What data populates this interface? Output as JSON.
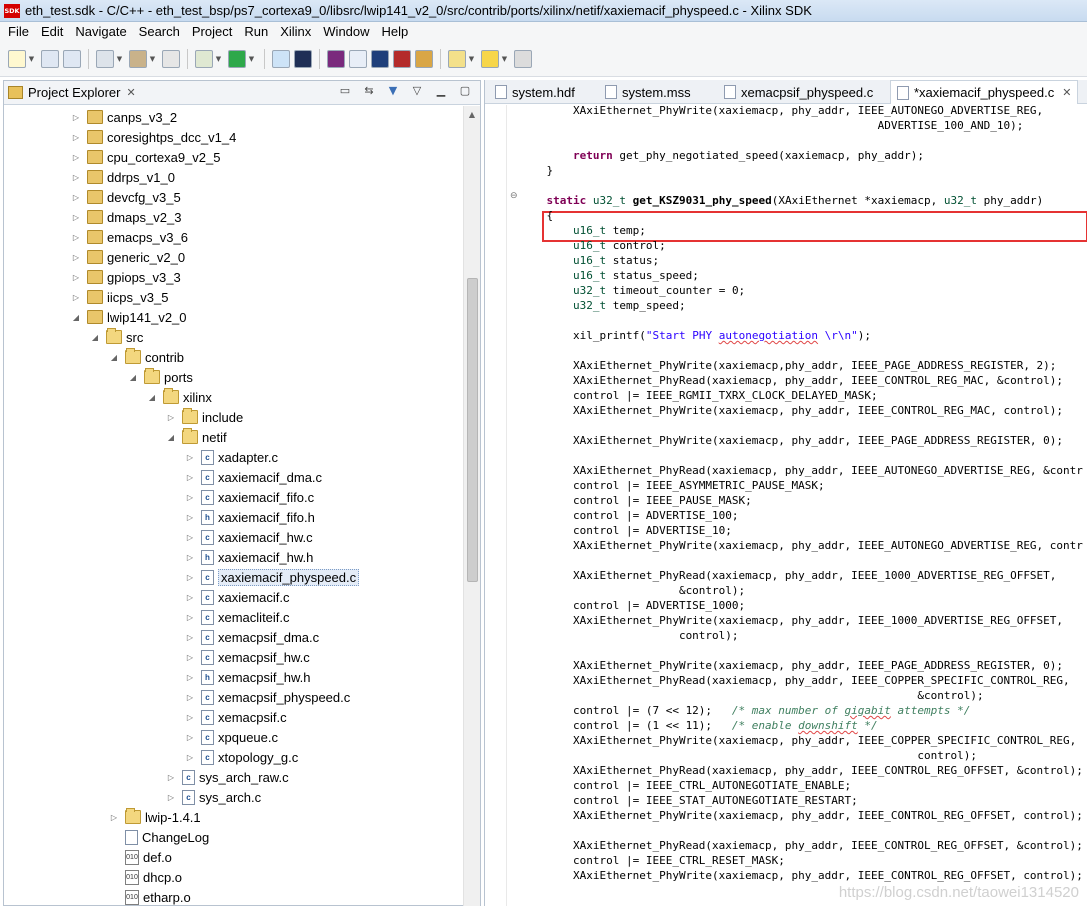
{
  "window": {
    "title": "eth_test.sdk - C/C++ - eth_test_bsp/ps7_cortexa9_0/libsrc/lwip141_v2_0/src/contrib/ports/xilinx/netif/xaxiemacif_physpeed.c - Xilinx SDK",
    "logo": "SDK"
  },
  "menu": [
    "File",
    "Edit",
    "Navigate",
    "Search",
    "Project",
    "Run",
    "Xilinx",
    "Window",
    "Help"
  ],
  "toolbar_icons": [
    "new-icon",
    "save-icon",
    "save-all-icon",
    "build-icon",
    "hammer-icon",
    "binary-icon",
    "debug-icon",
    "run-icon",
    "external-tools-icon",
    "terminal-icon",
    "program-fpga-icon",
    "sdk-icon",
    "console-icon",
    "xmd-icon",
    "search-icon",
    "edit-icon",
    "back-icon",
    "forward-icon"
  ],
  "project_explorer": {
    "title": "Project Explorer",
    "close_glyph": "✕",
    "tree": [
      {
        "label": "canps_v3_2",
        "type": "pkg",
        "arrow": "▷",
        "indent": 0
      },
      {
        "label": "coresightps_dcc_v1_4",
        "type": "pkg",
        "arrow": "▷",
        "indent": 0
      },
      {
        "label": "cpu_cortexa9_v2_5",
        "type": "pkg",
        "arrow": "▷",
        "indent": 0
      },
      {
        "label": "ddrps_v1_0",
        "type": "pkg",
        "arrow": "▷",
        "indent": 0
      },
      {
        "label": "devcfg_v3_5",
        "type": "pkg",
        "arrow": "▷",
        "indent": 0
      },
      {
        "label": "dmaps_v2_3",
        "type": "pkg",
        "arrow": "▷",
        "indent": 0
      },
      {
        "label": "emacps_v3_6",
        "type": "pkg",
        "arrow": "▷",
        "indent": 0
      },
      {
        "label": "generic_v2_0",
        "type": "pkg",
        "arrow": "▷",
        "indent": 0
      },
      {
        "label": "gpiops_v3_3",
        "type": "pkg",
        "arrow": "▷",
        "indent": 0
      },
      {
        "label": "iicps_v3_5",
        "type": "pkg",
        "arrow": "▷",
        "indent": 0
      },
      {
        "label": "lwip141_v2_0",
        "type": "pkg",
        "arrow": "◢",
        "indent": 0
      },
      {
        "label": "src",
        "type": "folder",
        "arrow": "◢",
        "indent": 1
      },
      {
        "label": "contrib",
        "type": "folder",
        "arrow": "◢",
        "indent": 2
      },
      {
        "label": "ports",
        "type": "folder",
        "arrow": "◢",
        "indent": 3
      },
      {
        "label": "xilinx",
        "type": "folder",
        "arrow": "◢",
        "indent": 4
      },
      {
        "label": "include",
        "type": "folder",
        "arrow": "▷",
        "indent": 5
      },
      {
        "label": "netif",
        "type": "folder",
        "arrow": "◢",
        "indent": 5
      },
      {
        "label": "xadapter.c",
        "type": "c",
        "arrow": "▷",
        "indent": 6
      },
      {
        "label": "xaxiemacif_dma.c",
        "type": "c",
        "arrow": "▷",
        "indent": 6
      },
      {
        "label": "xaxiemacif_fifo.c",
        "type": "c",
        "arrow": "▷",
        "indent": 6
      },
      {
        "label": "xaxiemacif_fifo.h",
        "type": "h",
        "arrow": "▷",
        "indent": 6
      },
      {
        "label": "xaxiemacif_hw.c",
        "type": "c",
        "arrow": "▷",
        "indent": 6
      },
      {
        "label": "xaxiemacif_hw.h",
        "type": "h",
        "arrow": "▷",
        "indent": 6
      },
      {
        "label": "xaxiemacif_physpeed.c",
        "type": "c",
        "arrow": "▷",
        "indent": 6,
        "selected": true
      },
      {
        "label": "xaxiemacif.c",
        "type": "c",
        "arrow": "▷",
        "indent": 6
      },
      {
        "label": "xemacliteif.c",
        "type": "c",
        "arrow": "▷",
        "indent": 6
      },
      {
        "label": "xemacpsif_dma.c",
        "type": "c",
        "arrow": "▷",
        "indent": 6
      },
      {
        "label": "xemacpsif_hw.c",
        "type": "c",
        "arrow": "▷",
        "indent": 6
      },
      {
        "label": "xemacpsif_hw.h",
        "type": "h",
        "arrow": "▷",
        "indent": 6
      },
      {
        "label": "xemacpsif_physpeed.c",
        "type": "c",
        "arrow": "▷",
        "indent": 6
      },
      {
        "label": "xemacpsif.c",
        "type": "c",
        "arrow": "▷",
        "indent": 6
      },
      {
        "label": "xpqueue.c",
        "type": "c",
        "arrow": "▷",
        "indent": 6
      },
      {
        "label": "xtopology_g.c",
        "type": "c",
        "arrow": "▷",
        "indent": 6
      },
      {
        "label": "sys_arch_raw.c",
        "type": "c",
        "arrow": "▷",
        "indent": 5
      },
      {
        "label": "sys_arch.c",
        "type": "c",
        "arrow": "▷",
        "indent": 5
      },
      {
        "label": "lwip-1.4.1",
        "type": "folder",
        "arrow": "▷",
        "indent": 2
      },
      {
        "label": "ChangeLog",
        "type": "txt",
        "arrow": "",
        "indent": 2
      },
      {
        "label": "def.o",
        "type": "obj",
        "arrow": "",
        "indent": 2
      },
      {
        "label": "dhcp.o",
        "type": "obj",
        "arrow": "",
        "indent": 2
      },
      {
        "label": "etharp.o",
        "type": "obj",
        "arrow": "",
        "indent": 2
      }
    ]
  },
  "editor": {
    "tabs": [
      {
        "label": "system.hdf",
        "active": false
      },
      {
        "label": "system.mss",
        "active": false
      },
      {
        "label": "xemacpsif_physpeed.c",
        "active": false
      },
      {
        "label": "*xaxiemacif_physpeed.c",
        "active": true
      }
    ],
    "tab_close_glyph": "✕",
    "fold_glyph": "⊖",
    "code": [
      [
        {
          "t": "        XAxiEthernet_PhyWrite(xaxiemacp, phy_addr, IEEE_AUTONEGO_ADVERTISE_REG,"
        }
      ],
      [
        {
          "t": "                                                      ADVERTISE_100_AND_10);"
        }
      ],
      [
        {
          "t": ""
        }
      ],
      [
        {
          "t": "        "
        },
        {
          "t": "return",
          "c": "kw"
        },
        {
          "t": " get_phy_negotiated_speed(xaxiemacp, phy_addr);"
        }
      ],
      [
        {
          "t": "    }"
        }
      ],
      [
        {
          "t": ""
        }
      ],
      [
        {
          "t": "    "
        },
        {
          "t": "static",
          "c": "kw"
        },
        {
          "t": " "
        },
        {
          "t": "u32_t",
          "c": "ty"
        },
        {
          "t": " "
        },
        {
          "t": "get_KSZ9031_phy_speed",
          "c": "fn"
        },
        {
          "t": "(XAxiEthernet *xaxiemacp, "
        },
        {
          "t": "u32_t",
          "c": "ty"
        },
        {
          "t": " phy_addr)"
        }
      ],
      [
        {
          "t": "    {"
        }
      ],
      [
        {
          "t": "        "
        },
        {
          "t": "u16_t",
          "c": "ty"
        },
        {
          "t": " temp;"
        }
      ],
      [
        {
          "t": "        "
        },
        {
          "t": "u16_t",
          "c": "ty"
        },
        {
          "t": " control;"
        }
      ],
      [
        {
          "t": "        "
        },
        {
          "t": "u16_t",
          "c": "ty"
        },
        {
          "t": " status;"
        }
      ],
      [
        {
          "t": "        "
        },
        {
          "t": "u16_t",
          "c": "ty"
        },
        {
          "t": " status_speed;"
        }
      ],
      [
        {
          "t": "        "
        },
        {
          "t": "u32_t",
          "c": "ty"
        },
        {
          "t": " timeout_counter = 0;"
        }
      ],
      [
        {
          "t": "        "
        },
        {
          "t": "u32_t",
          "c": "ty"
        },
        {
          "t": " temp_speed;"
        }
      ],
      [
        {
          "t": ""
        }
      ],
      [
        {
          "t": "        xil_printf("
        },
        {
          "t": "\"Start PHY ",
          "c": "str"
        },
        {
          "t": "autonegotiation",
          "c": "str sq"
        },
        {
          "t": " \\r\\n\"",
          "c": "str"
        },
        {
          "t": ");"
        }
      ],
      [
        {
          "t": ""
        }
      ],
      [
        {
          "t": "        XAxiEthernet_PhyWrite(xaxiemacp,phy_addr, IEEE_PAGE_ADDRESS_REGISTER, 2);"
        }
      ],
      [
        {
          "t": "        XAxiEthernet_PhyRead(xaxiemacp, phy_addr, IEEE_CONTROL_REG_MAC, &control);"
        }
      ],
      [
        {
          "t": "        control |= IEEE_RGMII_TXRX_CLOCK_DELAYED_MASK;"
        }
      ],
      [
        {
          "t": "        XAxiEthernet_PhyWrite(xaxiemacp, phy_addr, IEEE_CONTROL_REG_MAC, control);"
        }
      ],
      [
        {
          "t": ""
        }
      ],
      [
        {
          "t": "        XAxiEthernet_PhyWrite(xaxiemacp, phy_addr, IEEE_PAGE_ADDRESS_REGISTER, 0);"
        }
      ],
      [
        {
          "t": ""
        }
      ],
      [
        {
          "t": "        XAxiEthernet_PhyRead(xaxiemacp, phy_addr, IEEE_AUTONEGO_ADVERTISE_REG, &contr"
        }
      ],
      [
        {
          "t": "        control |= IEEE_ASYMMETRIC_PAUSE_MASK;"
        }
      ],
      [
        {
          "t": "        control |= IEEE_PAUSE_MASK;"
        }
      ],
      [
        {
          "t": "        control |= ADVERTISE_100;"
        }
      ],
      [
        {
          "t": "        control |= ADVERTISE_10;"
        }
      ],
      [
        {
          "t": "        XAxiEthernet_PhyWrite(xaxiemacp, phy_addr, IEEE_AUTONEGO_ADVERTISE_REG, contr"
        }
      ],
      [
        {
          "t": ""
        }
      ],
      [
        {
          "t": "        XAxiEthernet_PhyRead(xaxiemacp, phy_addr, IEEE_1000_ADVERTISE_REG_OFFSET,"
        }
      ],
      [
        {
          "t": "                        &control);"
        }
      ],
      [
        {
          "t": "        control |= ADVERTISE_1000;"
        }
      ],
      [
        {
          "t": "        XAxiEthernet_PhyWrite(xaxiemacp, phy_addr, IEEE_1000_ADVERTISE_REG_OFFSET,"
        }
      ],
      [
        {
          "t": "                        control);"
        }
      ],
      [
        {
          "t": ""
        }
      ],
      [
        {
          "t": "        XAxiEthernet_PhyWrite(xaxiemacp, phy_addr, IEEE_PAGE_ADDRESS_REGISTER, 0);"
        }
      ],
      [
        {
          "t": "        XAxiEthernet_PhyRead(xaxiemacp, phy_addr, IEEE_COPPER_SPECIFIC_CONTROL_REG,"
        }
      ],
      [
        {
          "t": "                                                            &control);"
        }
      ],
      [
        {
          "t": "        control |= (7 << 12);   "
        },
        {
          "t": "/* max number of ",
          "c": "cm"
        },
        {
          "t": "gigabit",
          "c": "cm sq"
        },
        {
          "t": " attempts */",
          "c": "cm"
        }
      ],
      [
        {
          "t": "        control |= (1 << 11);   "
        },
        {
          "t": "/* enable ",
          "c": "cm"
        },
        {
          "t": "downshift",
          "c": "cm sq"
        },
        {
          "t": " */",
          "c": "cm"
        }
      ],
      [
        {
          "t": "        XAxiEthernet_PhyWrite(xaxiemacp, phy_addr, IEEE_COPPER_SPECIFIC_CONTROL_REG,"
        }
      ],
      [
        {
          "t": "                                                            control);"
        }
      ],
      [
        {
          "t": "        XAxiEthernet_PhyRead(xaxiemacp, phy_addr, IEEE_CONTROL_REG_OFFSET, &control);"
        }
      ],
      [
        {
          "t": "        control |= IEEE_CTRL_AUTONEGOTIATE_ENABLE;"
        }
      ],
      [
        {
          "t": "        control |= IEEE_STAT_AUTONEGOTIATE_RESTART;"
        }
      ],
      [
        {
          "t": "        XAxiEthernet_PhyWrite(xaxiemacp, phy_addr, IEEE_CONTROL_REG_OFFSET, control);"
        }
      ],
      [
        {
          "t": ""
        }
      ],
      [
        {
          "t": "        XAxiEthernet_PhyRead(xaxiemacp, phy_addr, IEEE_CONTROL_REG_OFFSET, &control);"
        }
      ],
      [
        {
          "t": "        control |= IEEE_CTRL_RESET_MASK;"
        }
      ],
      [
        {
          "t": "        XAxiEthernet_PhyWrite(xaxiemacp, phy_addr, IEEE_CONTROL_REG_OFFSET, control);"
        }
      ]
    ]
  },
  "watermark": "https://blog.csdn.net/taowei1314520"
}
